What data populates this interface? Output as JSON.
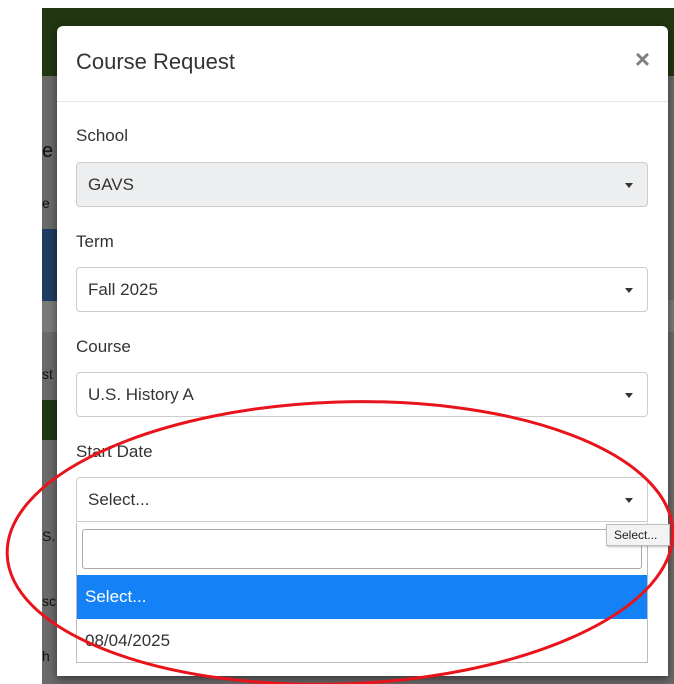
{
  "background_page": {
    "fragments": [
      "e",
      "e",
      "st",
      "S.",
      "sc",
      "h"
    ]
  },
  "modal": {
    "title": "Course Request",
    "close_glyph": "×",
    "fields": {
      "school": {
        "label": "School",
        "value": "GAVS"
      },
      "term": {
        "label": "Term",
        "value": "Fall 2025"
      },
      "course": {
        "label": "Course",
        "value": "U.S. History A"
      },
      "start_date": {
        "label": "Start Date",
        "value": "Select..."
      }
    },
    "dropdown": {
      "search_value": "",
      "options": [
        "Select...",
        "08/04/2025"
      ],
      "highlighted_option": "Select..."
    }
  },
  "tooltip": {
    "text": "Select..."
  },
  "colors": {
    "highlight": "#1482f6",
    "annotation": "#e8131b",
    "disabled_bg": "#eceeef"
  }
}
